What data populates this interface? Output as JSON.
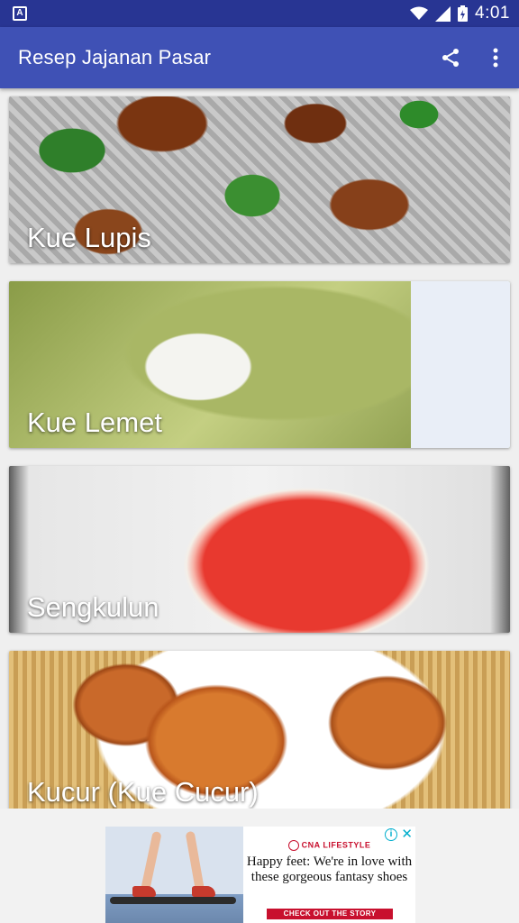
{
  "status_bar": {
    "time": "4:01",
    "left_icon": "app-notification-icon",
    "icons": [
      "wifi-icon",
      "signal-icon",
      "battery-charging-icon"
    ]
  },
  "app_bar": {
    "title": "Resep Jajanan Pasar",
    "actions": [
      "share-icon",
      "more-vert-icon"
    ],
    "color": "#3f51b5"
  },
  "recipes": [
    {
      "title": "Kue Lupis"
    },
    {
      "title": "Kue Lemet"
    },
    {
      "title": "Sengkulun"
    },
    {
      "title": "Kucur (Kue Cucur)"
    }
  ],
  "ad": {
    "brand": "CNA LIFESTYLE",
    "headline": "Happy feet: We're in love with these gorgeous fantasy shoes",
    "cta": "CHECK OUT THE STORY",
    "info_icon": "info-icon",
    "close_icon": "close-icon",
    "brand_color": "#c8102e"
  }
}
